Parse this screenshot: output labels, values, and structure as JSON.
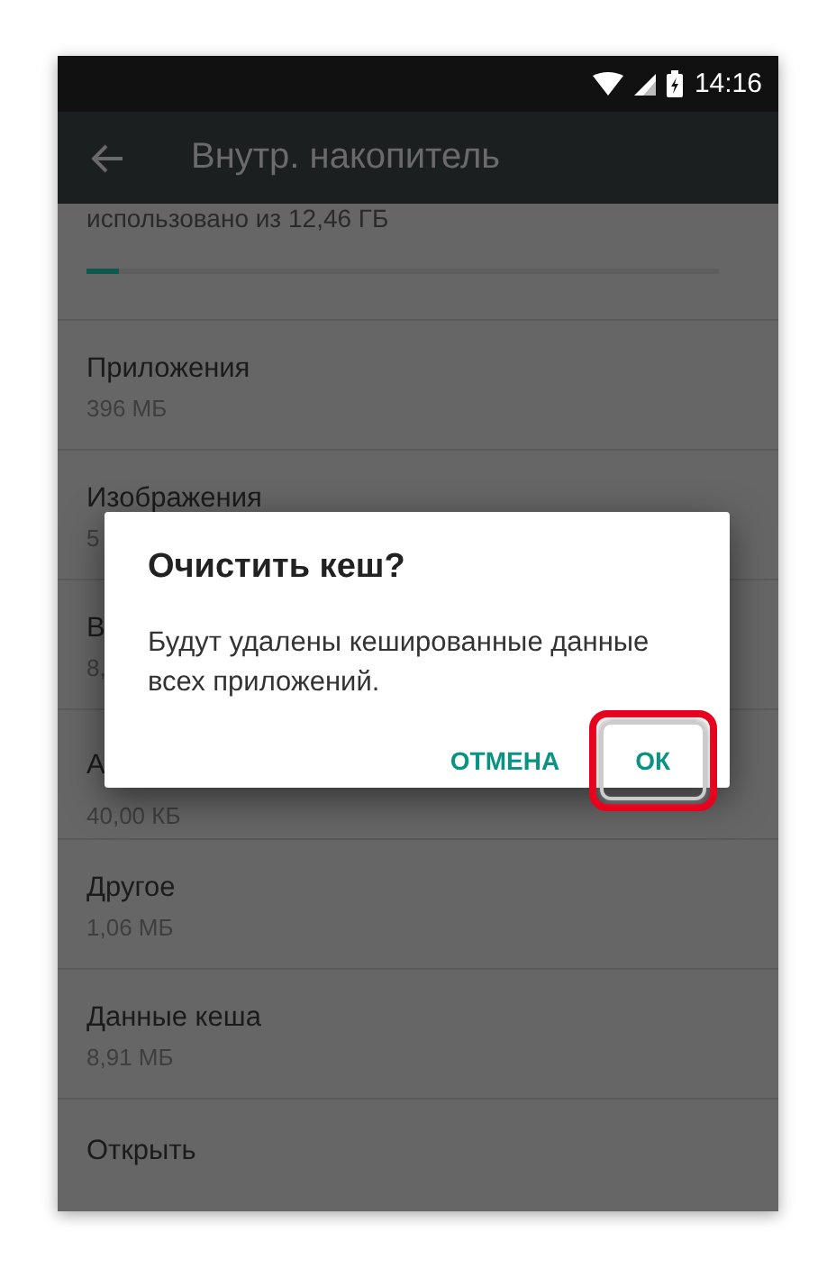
{
  "status_bar": {
    "time": "14:16"
  },
  "toolbar": {
    "title": "Внутр. накопитель"
  },
  "storage": {
    "summary": "использовано из 12,46 ГБ",
    "level": 0.05
  },
  "items": [
    {
      "title": "Приложения",
      "size": "396 МБ"
    },
    {
      "title": "Изображения",
      "size": "5"
    },
    {
      "title": "В",
      "size": "8,"
    },
    {
      "title": "А",
      "size": "40,00 КБ"
    },
    {
      "title": "Другое",
      "size": "1,06 МБ"
    },
    {
      "title": "Данные кеша",
      "size": "8,91 МБ"
    },
    {
      "title": "Открыть"
    }
  ],
  "dialog": {
    "title": "Очистить кеш?",
    "message": "Будут удалены кешированные данные всех приложений.",
    "buttons": [
      {
        "label": "ОТМЕНА",
        "highlighted": false
      },
      {
        "label": "ОК",
        "highlighted": true
      }
    ]
  }
}
